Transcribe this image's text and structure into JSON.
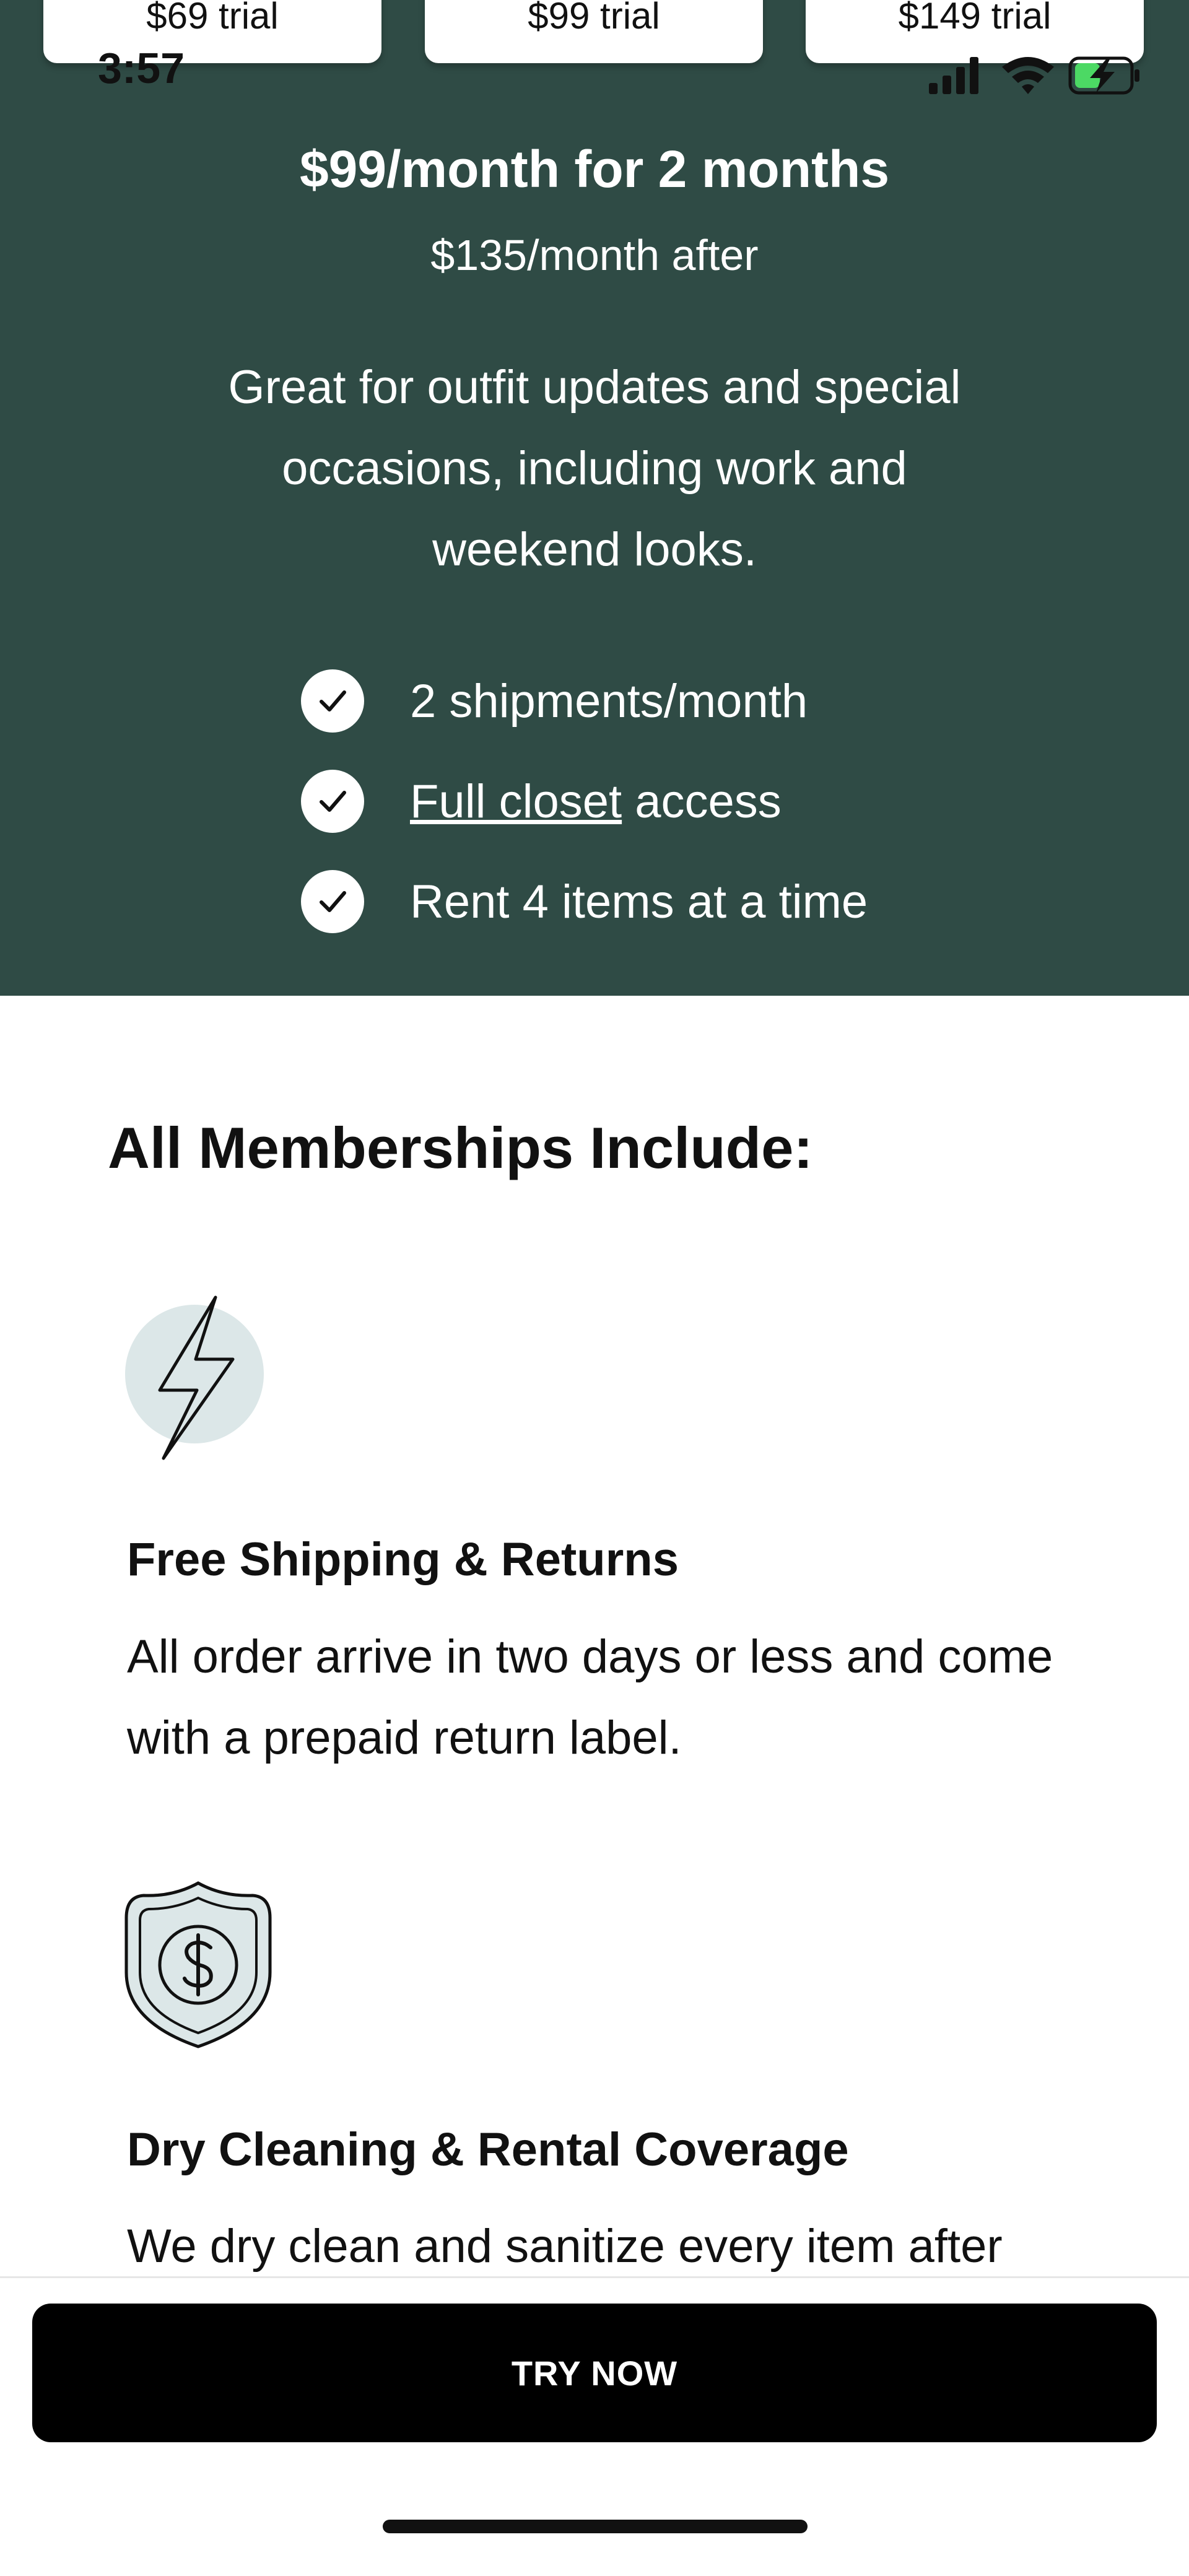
{
  "plan_tabs": [
    {
      "label": "$69 trial"
    },
    {
      "label": "$99 trial"
    },
    {
      "label": "$149 trial"
    }
  ],
  "status_bar": {
    "time": "3:57"
  },
  "plan": {
    "price": "$99/month for 2 months",
    "after_price": "$135/month after",
    "description": "Great for outfit updates and special occasions, including work and weekend looks.",
    "features": [
      {
        "text": "2 shipments/month"
      },
      {
        "link": "Full closet",
        "text": " access"
      },
      {
        "text": "Rent 4 items at a time"
      }
    ]
  },
  "section": {
    "title": "All Memberships Include:"
  },
  "benefits": [
    {
      "icon": "lightning-bolt-icon",
      "title": "Free Shipping & Returns",
      "description": "All order arrive in two days or less and come with a prepaid return label."
    },
    {
      "icon": "shield-dollar-icon",
      "title": "Dry Cleaning & Rental Coverage",
      "description": "We dry clean and sanitize every item after"
    }
  ],
  "cta": {
    "label": "TRY NOW"
  },
  "colors": {
    "hero_background": "#2f4b45",
    "icon_tint": "#dce7e8",
    "battery_green": "#4cd964",
    "button": "#000000"
  }
}
